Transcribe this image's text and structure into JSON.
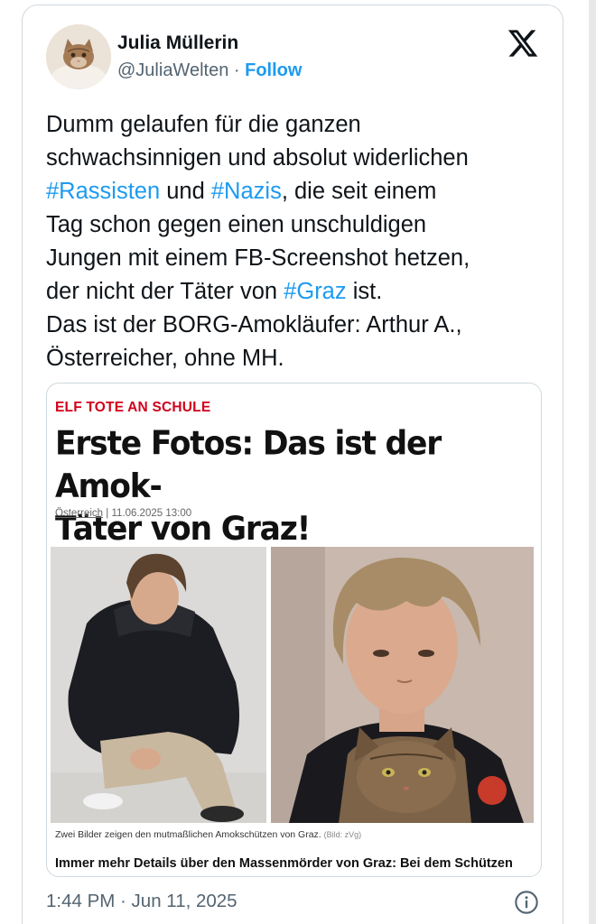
{
  "tweet": {
    "author": {
      "name": "Julia Müllerin",
      "handle": "@JuliaWelten",
      "separator": " · ",
      "follow_label": "Follow"
    },
    "platform_icon": "x-logo-icon",
    "text": {
      "l1": "Dumm gelaufen für die ganzen",
      "l2": "schwachsinnigen und absolut widerlichen",
      "l3_tag1": "#Rassisten",
      "l3_mid": " und ",
      "l3_tag2": "#Nazis",
      "l3_end": ", die seit einem",
      "l4": "Tag schon gegen einen unschuldigen",
      "l5": "Jungen mit einem FB-Screenshot hetzen,",
      "l6_start": "der nicht der Täter von ",
      "l6_tag": "#Graz",
      "l6_end": " ist.",
      "l7": "Das ist der BORG-Amokläufer: Arthur A.,",
      "l8": "Österreicher, ohne MH."
    },
    "hashtag_color": "#1d9bf0",
    "timestamp": "1:44 PM · Jun 11, 2025",
    "info_icon": "info-icon"
  },
  "article": {
    "kicker": "ELF TOTE AN SCHULE",
    "kicker_color": "#d0021b",
    "headline_line1": "Erste Fotos: Das ist der Amok-",
    "headline_line2": "Täter von Graz!",
    "section": "Österreich",
    "meta_sep": " | ",
    "date": "11.06.2025 13:00",
    "caption": "Zwei Bilder zeigen den mutmaßlichen Amokschützen von Graz.",
    "caption_credit": "(Bild: zVg)",
    "teaser": "Immer mehr Details über den Massenmörder von Graz: Bei dem Schützen"
  }
}
